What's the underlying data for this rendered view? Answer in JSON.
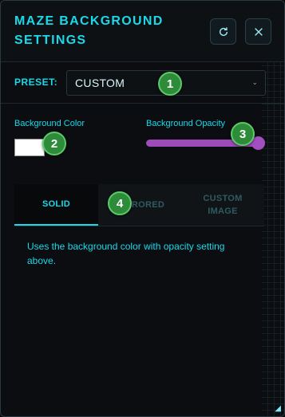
{
  "header": {
    "title": "MAZE BACKGROUND SETTINGS"
  },
  "preset": {
    "label": "PRESET:",
    "value": "CUSTOM"
  },
  "background_color": {
    "label": "Background Color",
    "value": "#ffffff"
  },
  "background_opacity": {
    "label": "Background Opacity",
    "value": 1.0
  },
  "tabs": [
    {
      "label": "SOLID",
      "active": true
    },
    {
      "label": "MIRRORED",
      "active": false
    },
    {
      "label": "CUSTOM IMAGE",
      "active": false
    }
  ],
  "description": "Uses the background color with opacity setting above.",
  "markers": [
    "1",
    "2",
    "3",
    "4"
  ],
  "colors": {
    "accent": "#19d9ea",
    "slider": "#9c4bb8",
    "marker": "#2e8b3a"
  }
}
